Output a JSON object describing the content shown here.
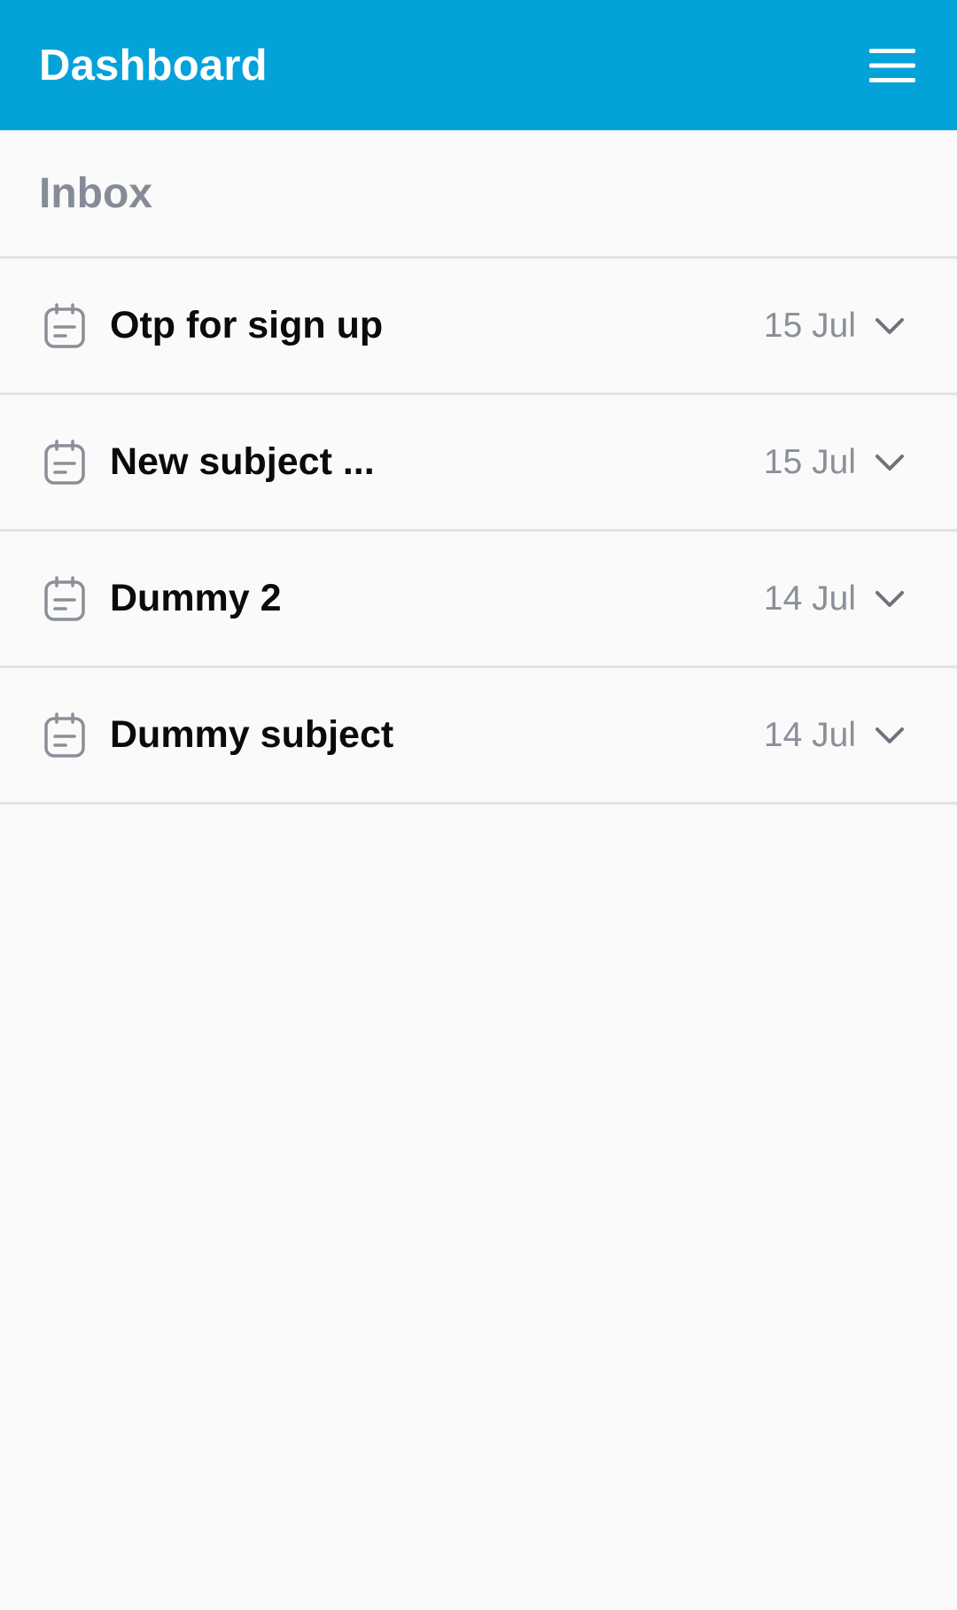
{
  "header": {
    "title": "Dashboard",
    "menu_icon": "hamburger-menu-icon",
    "background": "#03a2d9"
  },
  "section": {
    "title": "Inbox"
  },
  "messages": [
    {
      "subject": "Otp for sign up",
      "date": "15 Jul",
      "icon": "note-icon"
    },
    {
      "subject": "New subject ...",
      "date": "15 Jul",
      "icon": "note-icon"
    },
    {
      "subject": "Dummy 2",
      "date": "14 Jul",
      "icon": "note-icon"
    },
    {
      "subject": "Dummy subject",
      "date": "14 Jul",
      "icon": "note-icon"
    }
  ],
  "colors": {
    "accent": "#03a2d9",
    "muted_text": "#868c96",
    "divider": "#e3e3e3"
  }
}
